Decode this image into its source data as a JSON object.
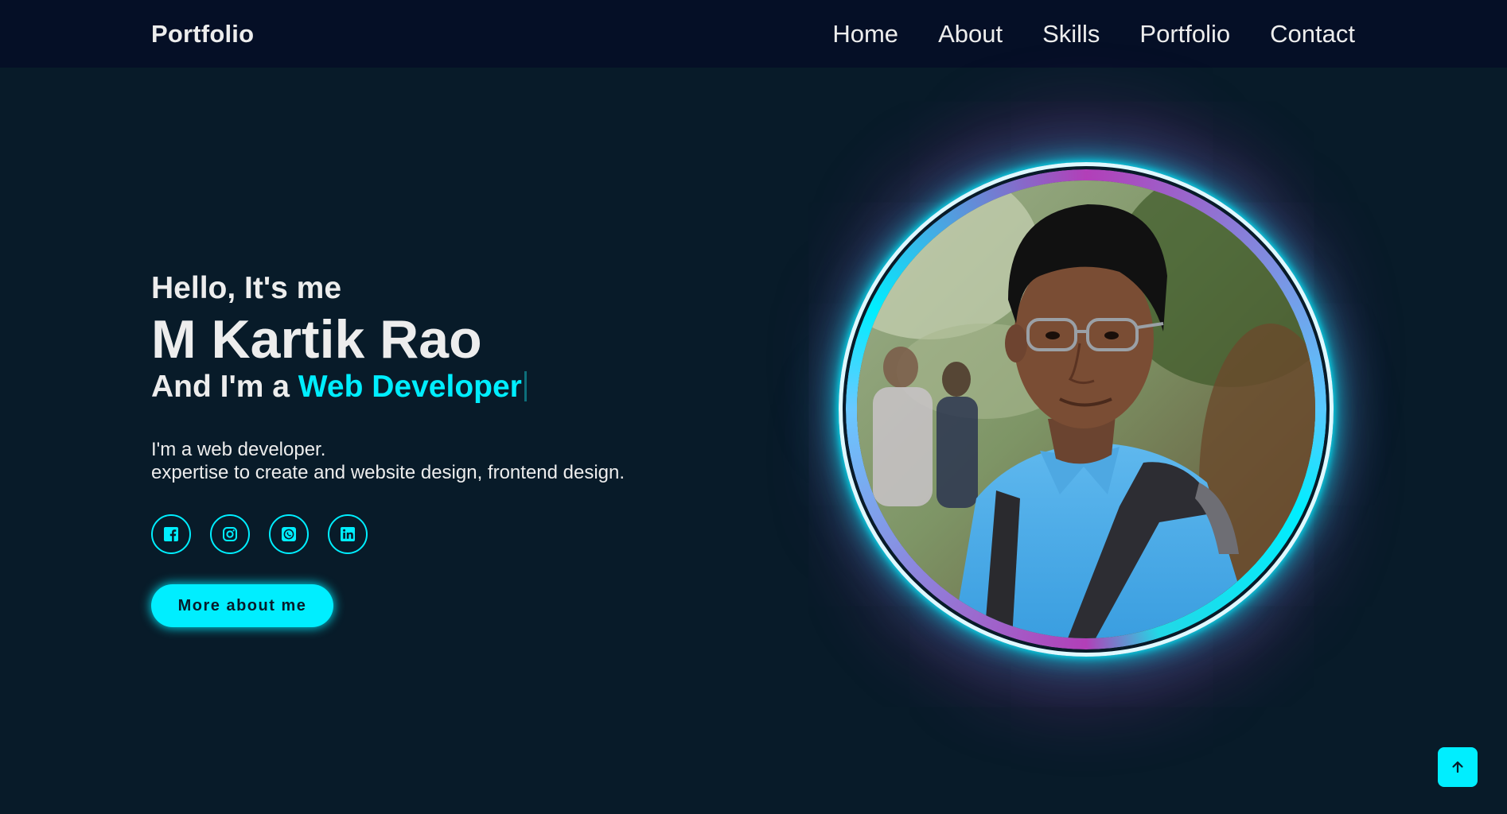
{
  "header": {
    "logo": "Portfolio",
    "nav": [
      {
        "label": "Home"
      },
      {
        "label": "About"
      },
      {
        "label": "Skills"
      },
      {
        "label": "Portfolio"
      },
      {
        "label": "Contact"
      }
    ]
  },
  "hero": {
    "greeting": "Hello, It's me",
    "name": "M Kartik Rao",
    "role_prefix": "And I'm a ",
    "role_highlight": "Web Developer",
    "description_lines": [
      "I'm a web developer.",
      "expertise to create and website design, frontend design."
    ],
    "social_icons": [
      "facebook-icon",
      "instagram-icon",
      "whatsapp-icon",
      "linkedin-icon"
    ],
    "button_label": "More about me"
  },
  "profile_image": {
    "alt": "Profile photo"
  },
  "back_to_top_icon": "arrow-up-icon",
  "colors": {
    "background": "#081b29",
    "header": "#050f26",
    "accent": "#00eeff",
    "text": "#ededed",
    "ring_secondary": "#b23fb8"
  }
}
